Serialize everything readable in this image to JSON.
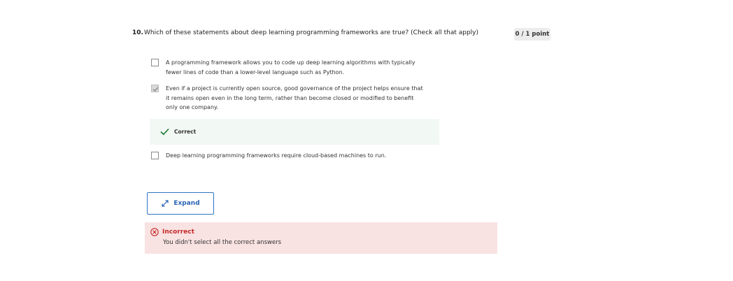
{
  "question": {
    "number": "10.",
    "text": "Which of these statements about deep learning programming frameworks are true? (Check all that apply)",
    "points": "0 / 1 point"
  },
  "options": [
    {
      "lines": [
        "A programming framework allows you to code up deep learning algorithms with typically",
        "fewer lines of code than a lower-level language such as Python."
      ],
      "checked": false
    },
    {
      "lines": [
        "Even if a project is currently open source, good governance of the project helps ensure that",
        "it remains open even in the long term, rather than become closed or modified to benefit",
        "only one company."
      ],
      "checked": true
    },
    {
      "lines": [
        "Deep learning programming frameworks require cloud-based machines to run."
      ],
      "checked": false
    }
  ],
  "feedback": {
    "correct_label": "Correct"
  },
  "expand_button": {
    "label": "Expand"
  },
  "result": {
    "title": "Incorrect",
    "message": "You didn't select all the correct answers"
  },
  "colors": {
    "accent": "#2a64b5",
    "correct_green": "#1e7b34",
    "incorrect_red": "#c62828",
    "incorrect_bg": "#f9e2e2",
    "correct_bg": "#f2f8f4"
  },
  "icons": {
    "checkmark": "check-icon",
    "expand": "expand-arrows-icon",
    "error": "error-circle-icon"
  }
}
